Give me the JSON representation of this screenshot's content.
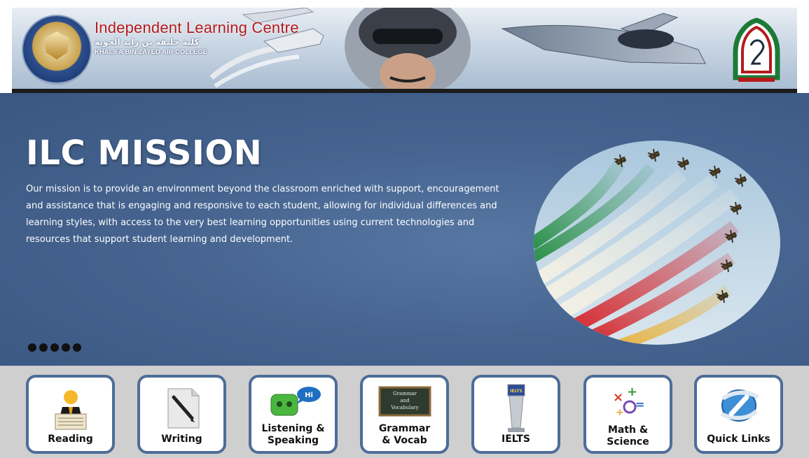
{
  "header": {
    "title": "Independent Learning Centre",
    "arabic_name": "كلية خليفة بن زايد الجوية",
    "college_name": "KHALIFA BIN ZAYED AIR COLLEGE"
  },
  "mission": {
    "title": "ILC MISSION",
    "text": "Our mission is to provide an environment beyond the classroom enriched with support, encouragement and assistance that is engaging and responsive to each student, allowing for individual differences and learning styles, with access to the very best learning opportunities using current technologies and resources that support student learning and development.",
    "slide_count": 5
  },
  "nav": {
    "tiles": [
      {
        "label": "Reading",
        "icon": "reading-icon"
      },
      {
        "label": "Writing",
        "icon": "writing-icon"
      },
      {
        "label": "Listening & Speaking",
        "icon": "listening-speaking-icon"
      },
      {
        "label": "Grammar & Vocab",
        "icon": "grammar-vocab-icon"
      },
      {
        "label": "IELTS",
        "icon": "ielts-icon"
      },
      {
        "label": "Math & Science",
        "icon": "math-science-icon"
      },
      {
        "label": "Quick Links",
        "icon": "quick-links-icon"
      }
    ],
    "icon_text": {
      "speech_bubble": "Hi",
      "chalkboard_1": "Grammar",
      "chalkboard_2": "and",
      "chalkboard_3": "Vocabulary",
      "kiosk_screen": "IELTS"
    }
  },
  "colors": {
    "mission_bg": "#46648f",
    "tile_border": "#4d6d98",
    "brand_red": "#b31b1b",
    "navbar_bg": "#cfcfcf"
  }
}
